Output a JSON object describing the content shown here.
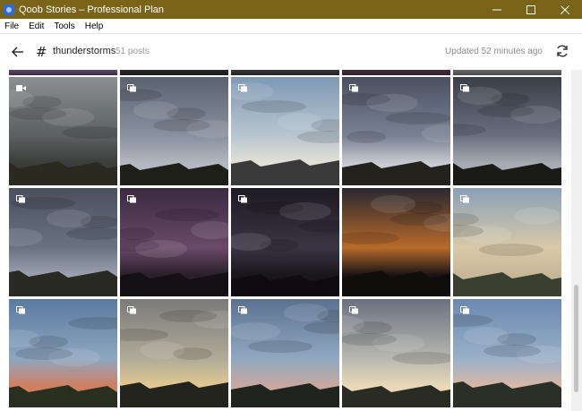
{
  "window": {
    "title": "Qoob Stories – Professional Plan",
    "controls": [
      "minimize-icon",
      "maximize-icon",
      "close-icon"
    ]
  },
  "menu": {
    "items": [
      "File",
      "Edit",
      "Tools",
      "Help"
    ]
  },
  "header": {
    "back_icon": "arrow-left-icon",
    "hash_symbol": "#",
    "tag_name": "thunderstorms",
    "post_count": "51 posts",
    "updated": "Updated 52 minutes ago",
    "refresh_icon": "refresh-icon"
  },
  "grid": {
    "partial_top_row": [
      {
        "sky": [
          "#5a4a6a",
          "#3a3040"
        ]
      },
      {
        "sky": [
          "#2a2a2a",
          "#1a1a1a"
        ]
      },
      {
        "sky": [
          "#3a3a3a",
          "#222222"
        ]
      },
      {
        "sky": [
          "#4a2f3a",
          "#2a2030"
        ]
      },
      {
        "sky": [
          "#6a6a6a",
          "#4a4a4a"
        ]
      }
    ],
    "rows": [
      [
        {
          "type": "video",
          "sky": [
            "#8b8f8f",
            "#5a5f5f",
            "#3a3d3a"
          ],
          "ground": "#2c2a20"
        },
        {
          "type": "gallery",
          "sky": [
            "#5a6270",
            "#8a92a0",
            "#b4b8c0"
          ],
          "ground": "#1f1f1a"
        },
        {
          "type": "gallery",
          "sky": [
            "#7e99b4",
            "#b9c6d0",
            "#e5e1d6"
          ],
          "ground": "#3a3a3a"
        },
        {
          "type": "gallery",
          "sky": [
            "#4a5060",
            "#7a8294",
            "#c9ccd2"
          ],
          "ground": "#24221c"
        },
        {
          "type": "gallery",
          "sky": [
            "#3a3e48",
            "#6a7080",
            "#a8acb2"
          ],
          "ground": "#1a1a16"
        }
      ],
      [
        {
          "type": "gallery",
          "sky": [
            "#4a505c",
            "#6a7282",
            "#9aa0ae"
          ],
          "ground": "#2a2a24"
        },
        {
          "type": "gallery",
          "sky": [
            "#3a2a40",
            "#6a4a68",
            "#2a1f2a"
          ],
          "ground": "#141014"
        },
        {
          "type": "gallery",
          "sky": [
            "#1e1a22",
            "#3a3444",
            "#1a161c"
          ],
          "ground": "#0e0c10"
        },
        {
          "type": "none",
          "sky": [
            "#2a2830",
            "#b86a2a",
            "#1a1416"
          ],
          "ground": "#100e0c"
        },
        {
          "type": "gallery",
          "sky": [
            "#8aa0b8",
            "#d9c9a8",
            "#c8b698"
          ],
          "ground": "#3a4030"
        }
      ],
      [
        {
          "type": "gallery",
          "sky": [
            "#5a7aa0",
            "#8ea6c0",
            "#d08060"
          ],
          "ground": "#2a3020"
        },
        {
          "type": "gallery",
          "sky": [
            "#7a7a78",
            "#b0aa98",
            "#e2c890"
          ],
          "ground": "#24241e"
        },
        {
          "type": "gallery",
          "sky": [
            "#5a7290",
            "#90a8c0",
            "#c8a8a0"
          ],
          "ground": "#20241e"
        },
        {
          "type": "gallery",
          "sky": [
            "#6a7080",
            "#b8b8b0",
            "#e8d8b8"
          ],
          "ground": "#2a2c24"
        },
        {
          "type": "gallery",
          "sky": [
            "#6a88b0",
            "#9ab0c8",
            "#d8b8a8"
          ],
          "ground": "#2a3028"
        }
      ]
    ]
  }
}
